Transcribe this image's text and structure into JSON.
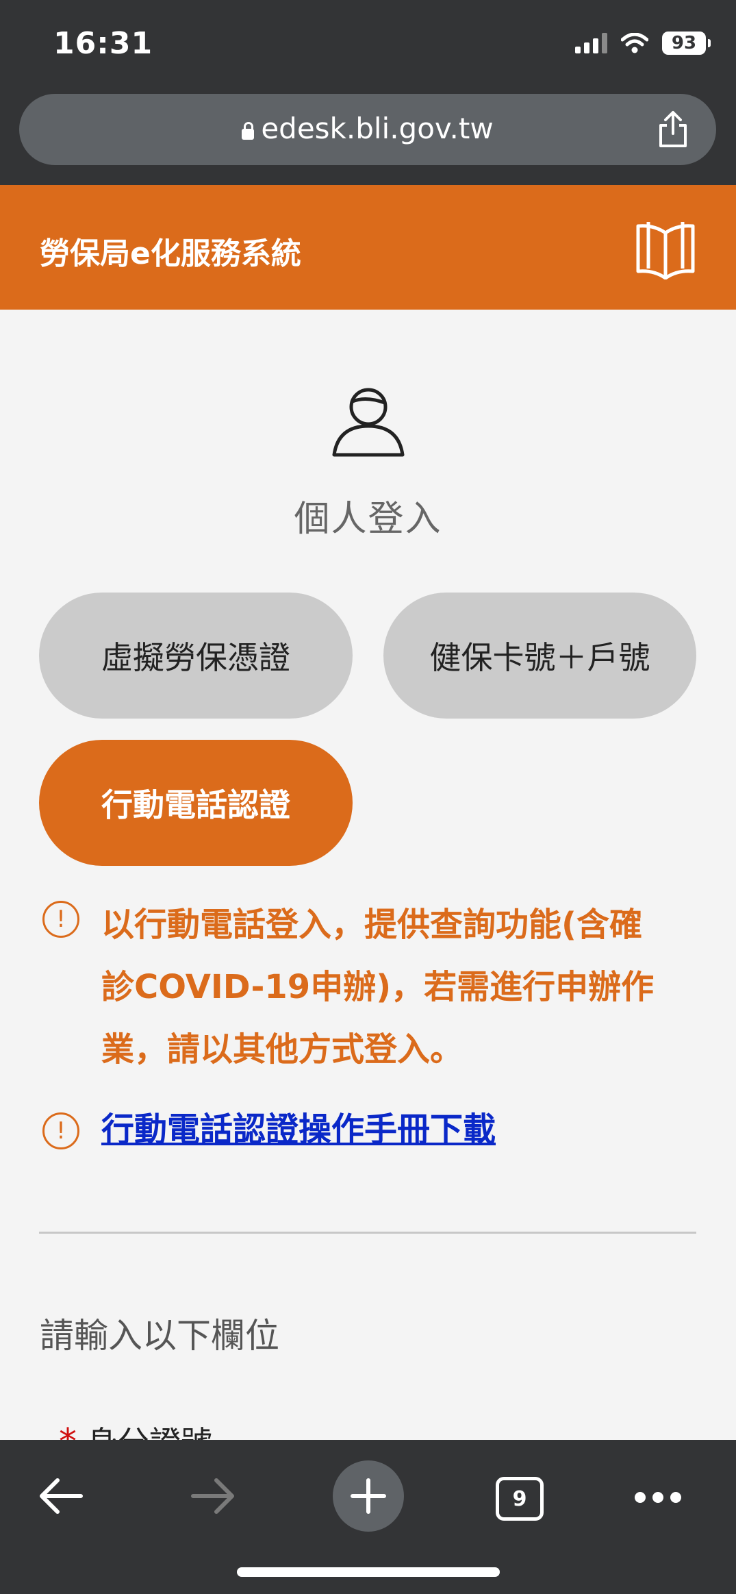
{
  "status_bar": {
    "time": "16:31",
    "battery": "93"
  },
  "browser": {
    "url": "edesk.bli.gov.tw",
    "tabs_count": "9"
  },
  "header": {
    "title": "勞保局e化服務系統",
    "manual_icon": "book-icon"
  },
  "login": {
    "title": "個人登入",
    "methods": [
      {
        "label": "虛擬勞保憑證",
        "state": "inactive"
      },
      {
        "label": "健保卡號＋戶號",
        "state": "inactive"
      },
      {
        "label": "行動電話認證",
        "state": "active"
      }
    ],
    "notices": [
      {
        "icon": "!",
        "lines": [
          "以行動電話登入，提供查詢功能(含確",
          "診COVID-19申辦)，若需進行申辦作",
          "業，請以其他方式登入。"
        ]
      },
      {
        "icon": "!",
        "link_text": "行動電話認證操作手冊下載"
      }
    ]
  },
  "form": {
    "section_label": "請輸入以下欄位",
    "fields": [
      {
        "label": "身分證號",
        "required_mark": "*"
      }
    ]
  },
  "colors": {
    "brand": "#db6b1b",
    "link": "#0a28c8",
    "browser_chrome": "#333436"
  }
}
